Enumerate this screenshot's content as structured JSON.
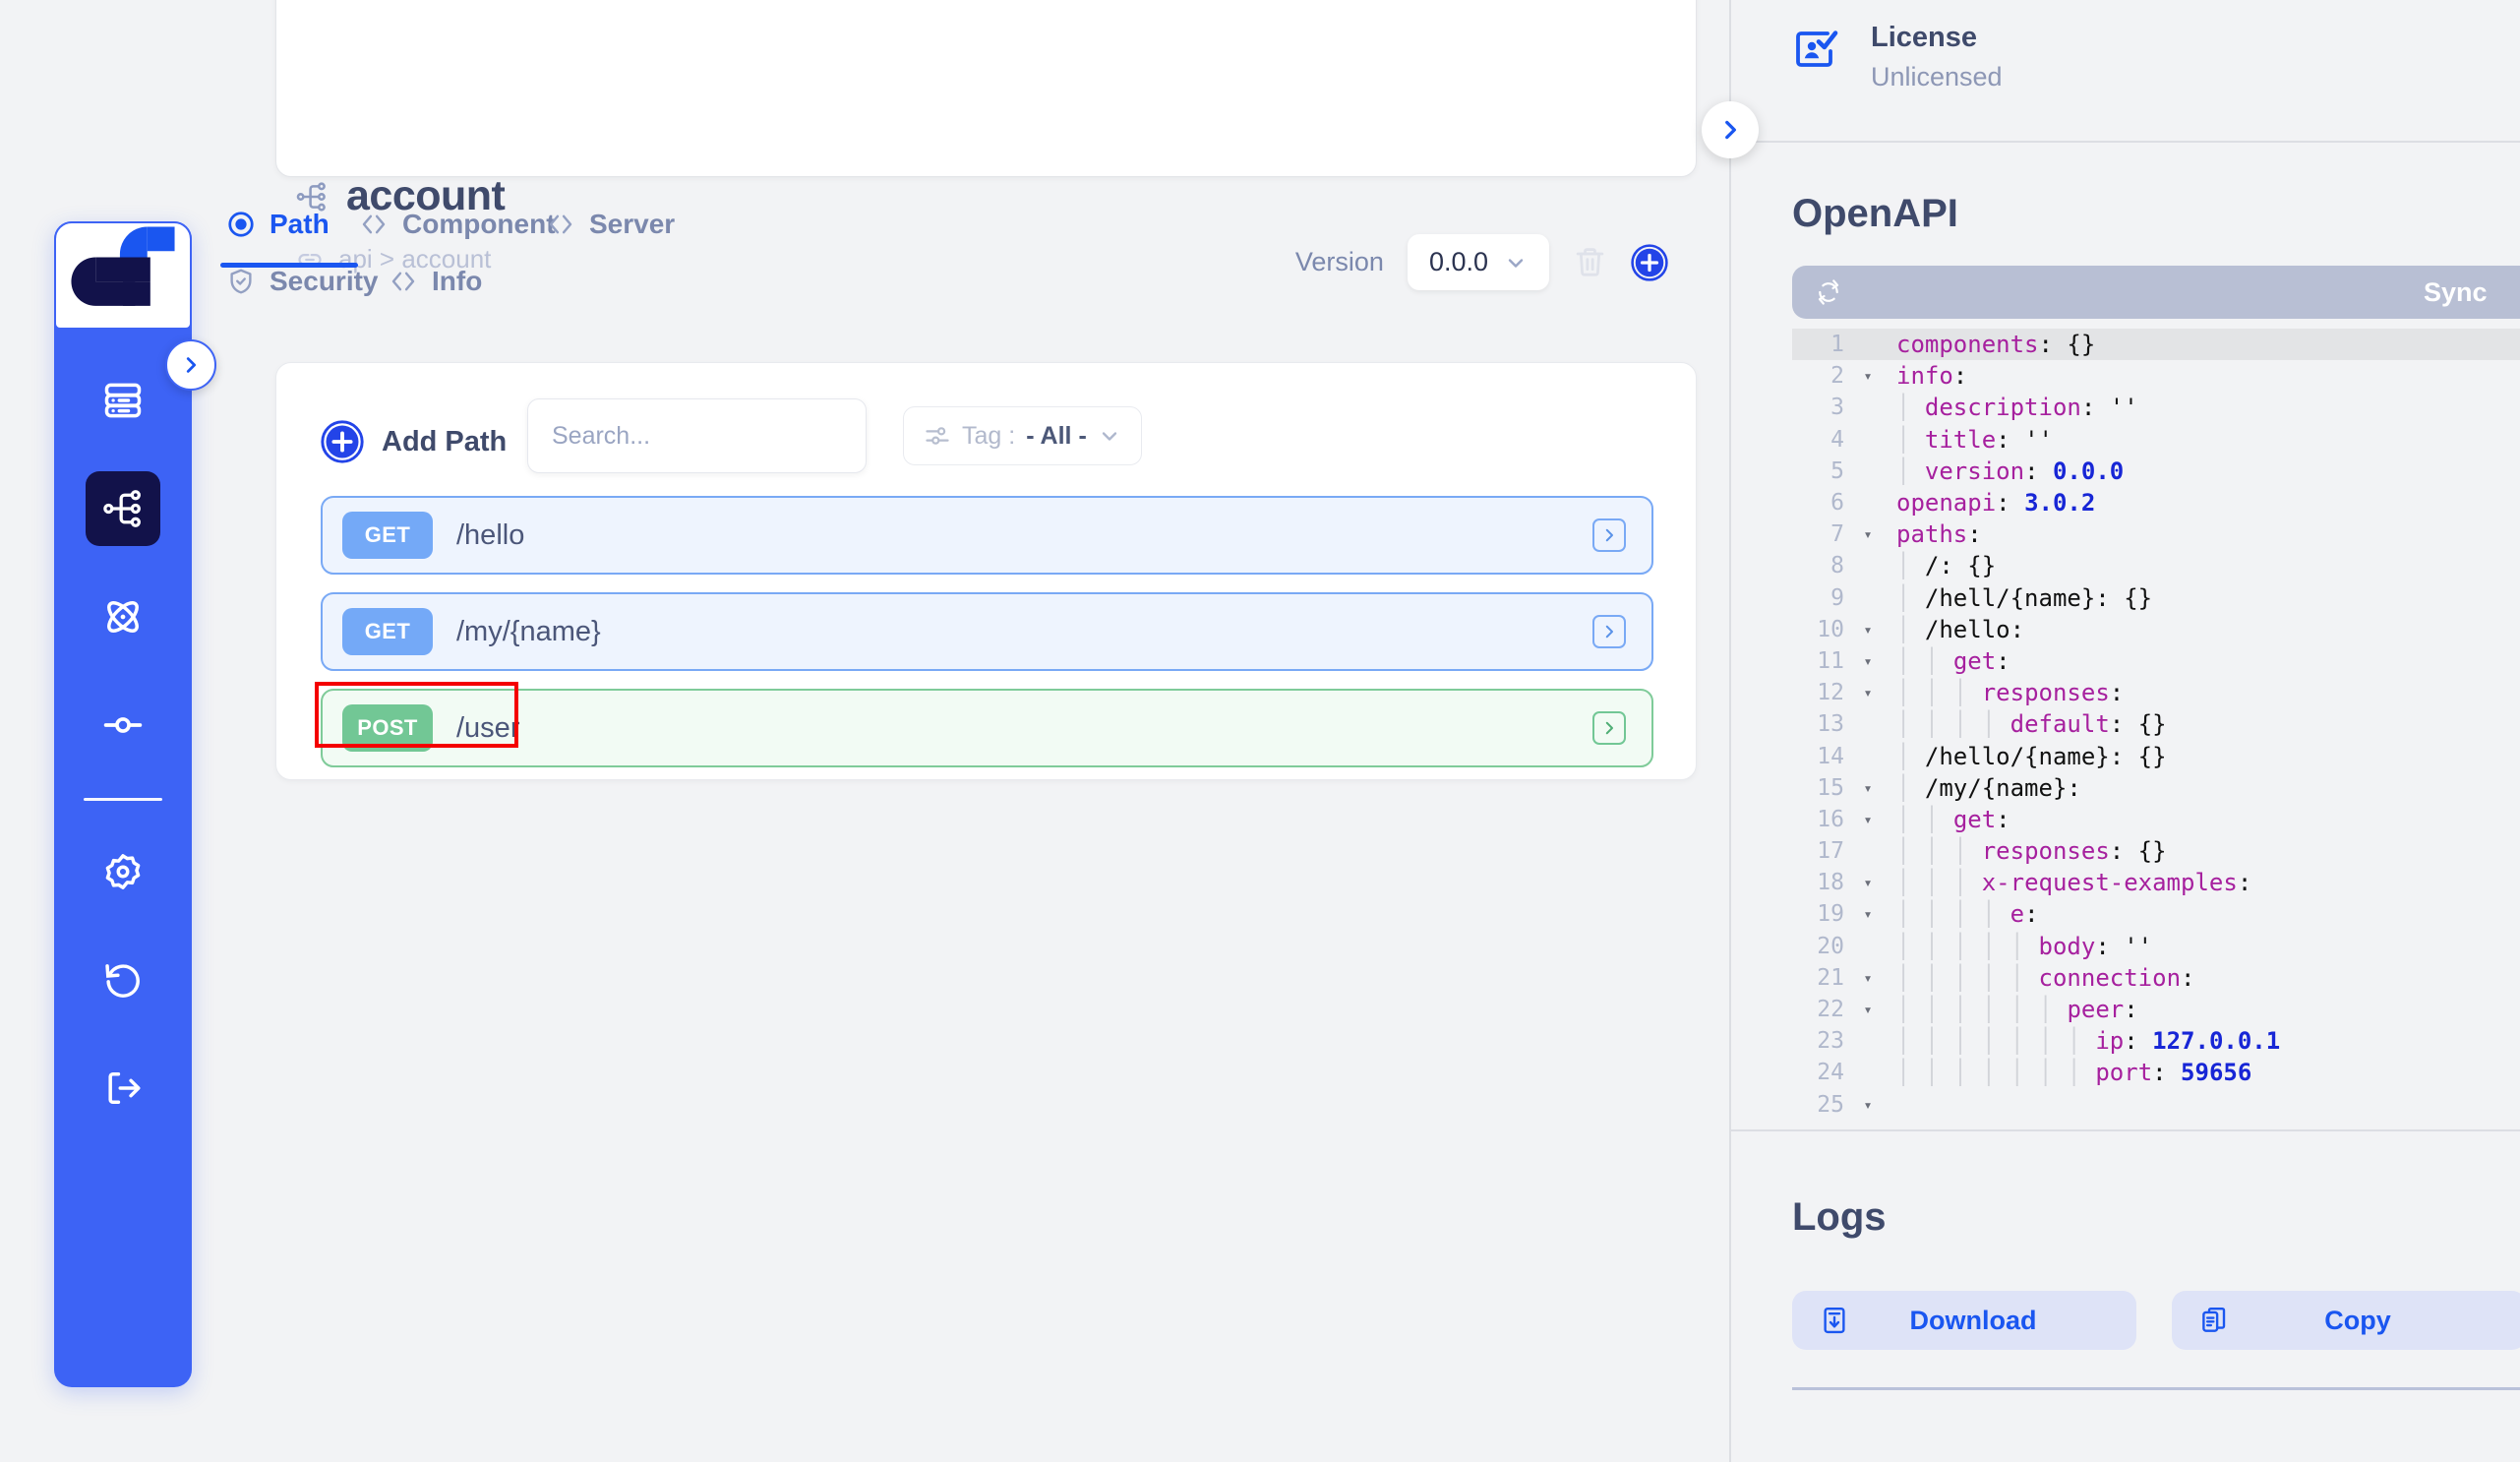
{
  "sidebar": {
    "logo_name": "df-logo",
    "toggle_icon": "chevron-right-icon",
    "items": [
      {
        "name": "server",
        "icon": "server-icon",
        "active": false
      },
      {
        "name": "api-tree",
        "icon": "sitemap-icon",
        "active": true
      },
      {
        "name": "atom",
        "icon": "atom-icon",
        "active": false
      },
      {
        "name": "node",
        "icon": "node-endpoint-icon",
        "active": false
      },
      {
        "name": "settings",
        "icon": "gear-icon",
        "active": false
      },
      {
        "name": "history",
        "icon": "undo-icon",
        "active": false
      },
      {
        "name": "logout",
        "icon": "logout-icon",
        "active": false
      }
    ]
  },
  "header": {
    "title": "account",
    "title_icon": "sitemap-icon",
    "breadcrumb": "api > account",
    "breadcrumb_icon": "link-icon"
  },
  "tabs": {
    "row1": [
      {
        "label": "Path",
        "icon": "radio-selected-icon",
        "active": true
      },
      {
        "label": "Component",
        "icon": "code-brackets-icon",
        "active": false
      },
      {
        "label": "Server",
        "icon": "code-brackets-icon",
        "active": false
      }
    ],
    "row2": [
      {
        "label": "Security",
        "icon": "shield-check-icon",
        "active": false
      },
      {
        "label": "Info",
        "icon": "code-brackets-icon",
        "active": false
      }
    ]
  },
  "version": {
    "label": "Version",
    "value": "0.0.0",
    "dropdown_icon": "chevron-down-icon",
    "delete_icon": "trash-icon",
    "add_icon": "plus-circle-icon"
  },
  "toolbar": {
    "add_path_label": "Add Path",
    "add_path_icon": "plus-circle-icon",
    "search_placeholder": "Search...",
    "search_value": "",
    "search_icon": "search-icon",
    "tag_icon": "filter-sliders-icon",
    "tag_label": "Tag :",
    "tag_value": "- All -",
    "tag_chevron": "chevron-down-icon"
  },
  "paths": [
    {
      "method": "GET",
      "path": "/hello",
      "style": "get",
      "chevron": "chevron-right-icon",
      "highlighted": false
    },
    {
      "method": "GET",
      "path": "/my/{name}",
      "style": "get",
      "chevron": "chevron-right-icon",
      "highlighted": false
    },
    {
      "method": "POST",
      "path": "/user",
      "style": "post",
      "chevron": "chevron-right-icon",
      "highlighted": true
    }
  ],
  "right_panel": {
    "toggle_icon": "chevron-right-icon",
    "license": {
      "icon": "license-card-check-icon",
      "title": "License",
      "value": "Unlicensed"
    },
    "openapi": {
      "title": "OpenAPI",
      "sync_label": "Sync",
      "sync_icon": "refresh-icon",
      "code_lines": [
        {
          "n": 1,
          "fold": false,
          "current": true,
          "indent": 0,
          "tokens": [
            {
              "t": "components",
              "c": "k"
            },
            {
              "t": ": ",
              "c": "p"
            },
            {
              "t": "{}",
              "c": "p"
            }
          ]
        },
        {
          "n": 2,
          "fold": true,
          "current": false,
          "indent": 0,
          "tokens": [
            {
              "t": "info",
              "c": "k"
            },
            {
              "t": ":",
              "c": "p"
            }
          ]
        },
        {
          "n": 3,
          "fold": false,
          "current": false,
          "indent": 1,
          "tokens": [
            {
              "t": "description",
              "c": "k"
            },
            {
              "t": ": ",
              "c": "p"
            },
            {
              "t": "''",
              "c": "p"
            }
          ]
        },
        {
          "n": 4,
          "fold": false,
          "current": false,
          "indent": 1,
          "tokens": [
            {
              "t": "title",
              "c": "k"
            },
            {
              "t": ": ",
              "c": "p"
            },
            {
              "t": "''",
              "c": "p"
            }
          ]
        },
        {
          "n": 5,
          "fold": false,
          "current": false,
          "indent": 1,
          "tokens": [
            {
              "t": "version",
              "c": "k"
            },
            {
              "t": ": ",
              "c": "p"
            },
            {
              "t": "0.0.0",
              "c": "v"
            }
          ]
        },
        {
          "n": 6,
          "fold": false,
          "current": false,
          "indent": 0,
          "tokens": [
            {
              "t": "openapi",
              "c": "k"
            },
            {
              "t": ": ",
              "c": "p"
            },
            {
              "t": "3.0.2",
              "c": "v"
            }
          ]
        },
        {
          "n": 7,
          "fold": true,
          "current": false,
          "indent": 0,
          "tokens": [
            {
              "t": "paths",
              "c": "k"
            },
            {
              "t": ":",
              "c": "p"
            }
          ]
        },
        {
          "n": 8,
          "fold": false,
          "current": false,
          "indent": 1,
          "tokens": [
            {
              "t": "/: {}",
              "c": "p"
            }
          ]
        },
        {
          "n": 9,
          "fold": false,
          "current": false,
          "indent": 1,
          "tokens": [
            {
              "t": "/hell/{name}: {}",
              "c": "p"
            }
          ]
        },
        {
          "n": 10,
          "fold": true,
          "current": false,
          "indent": 1,
          "tokens": [
            {
              "t": "/hello:",
              "c": "p"
            }
          ]
        },
        {
          "n": 11,
          "fold": true,
          "current": false,
          "indent": 2,
          "tokens": [
            {
              "t": "get",
              "c": "k"
            },
            {
              "t": ":",
              "c": "p"
            }
          ]
        },
        {
          "n": 12,
          "fold": true,
          "current": false,
          "indent": 3,
          "tokens": [
            {
              "t": "responses",
              "c": "k"
            },
            {
              "t": ":",
              "c": "p"
            }
          ]
        },
        {
          "n": 13,
          "fold": false,
          "current": false,
          "indent": 4,
          "tokens": [
            {
              "t": "default",
              "c": "k"
            },
            {
              "t": ": ",
              "c": "p"
            },
            {
              "t": "{}",
              "c": "p"
            }
          ]
        },
        {
          "n": 14,
          "fold": false,
          "current": false,
          "indent": 1,
          "tokens": [
            {
              "t": "/hello/{name}: {}",
              "c": "p"
            }
          ]
        },
        {
          "n": 15,
          "fold": true,
          "current": false,
          "indent": 1,
          "tokens": [
            {
              "t": "/my/{name}:",
              "c": "p"
            }
          ]
        },
        {
          "n": 16,
          "fold": true,
          "current": false,
          "indent": 2,
          "tokens": [
            {
              "t": "get",
              "c": "k"
            },
            {
              "t": ":",
              "c": "p"
            }
          ]
        },
        {
          "n": 17,
          "fold": false,
          "current": false,
          "indent": 3,
          "tokens": [
            {
              "t": "responses",
              "c": "k"
            },
            {
              "t": ": ",
              "c": "p"
            },
            {
              "t": "{}",
              "c": "p"
            }
          ]
        },
        {
          "n": 18,
          "fold": true,
          "current": false,
          "indent": 3,
          "tokens": [
            {
              "t": "x-request-examples",
              "c": "k"
            },
            {
              "t": ":",
              "c": "p"
            }
          ]
        },
        {
          "n": 19,
          "fold": true,
          "current": false,
          "indent": 4,
          "tokens": [
            {
              "t": "e",
              "c": "k"
            },
            {
              "t": ":",
              "c": "p"
            }
          ]
        },
        {
          "n": 20,
          "fold": false,
          "current": false,
          "indent": 5,
          "tokens": [
            {
              "t": "body",
              "c": "k"
            },
            {
              "t": ": ",
              "c": "p"
            },
            {
              "t": "''",
              "c": "p"
            }
          ]
        },
        {
          "n": 21,
          "fold": true,
          "current": false,
          "indent": 5,
          "tokens": [
            {
              "t": "connection",
              "c": "k"
            },
            {
              "t": ":",
              "c": "p"
            }
          ]
        },
        {
          "n": 22,
          "fold": true,
          "current": false,
          "indent": 6,
          "tokens": [
            {
              "t": "peer",
              "c": "k"
            },
            {
              "t": ":",
              "c": "p"
            }
          ]
        },
        {
          "n": 23,
          "fold": false,
          "current": false,
          "indent": 7,
          "tokens": [
            {
              "t": "ip",
              "c": "k"
            },
            {
              "t": ": ",
              "c": "p"
            },
            {
              "t": "127.0.0.1",
              "c": "v"
            }
          ]
        },
        {
          "n": 24,
          "fold": false,
          "current": false,
          "indent": 7,
          "tokens": [
            {
              "t": "port",
              "c": "k"
            },
            {
              "t": ": ",
              "c": "p"
            },
            {
              "t": "59656",
              "c": "v"
            }
          ]
        },
        {
          "n": 25,
          "fold": true,
          "current": false,
          "indent": 0,
          "tokens": [
            {
              "t": "",
              "c": "p"
            }
          ]
        }
      ]
    },
    "logs": {
      "title": "Logs",
      "download_label": "Download",
      "download_icon": "download-icon",
      "copy_label": "Copy",
      "copy_icon": "copy-icon"
    }
  }
}
